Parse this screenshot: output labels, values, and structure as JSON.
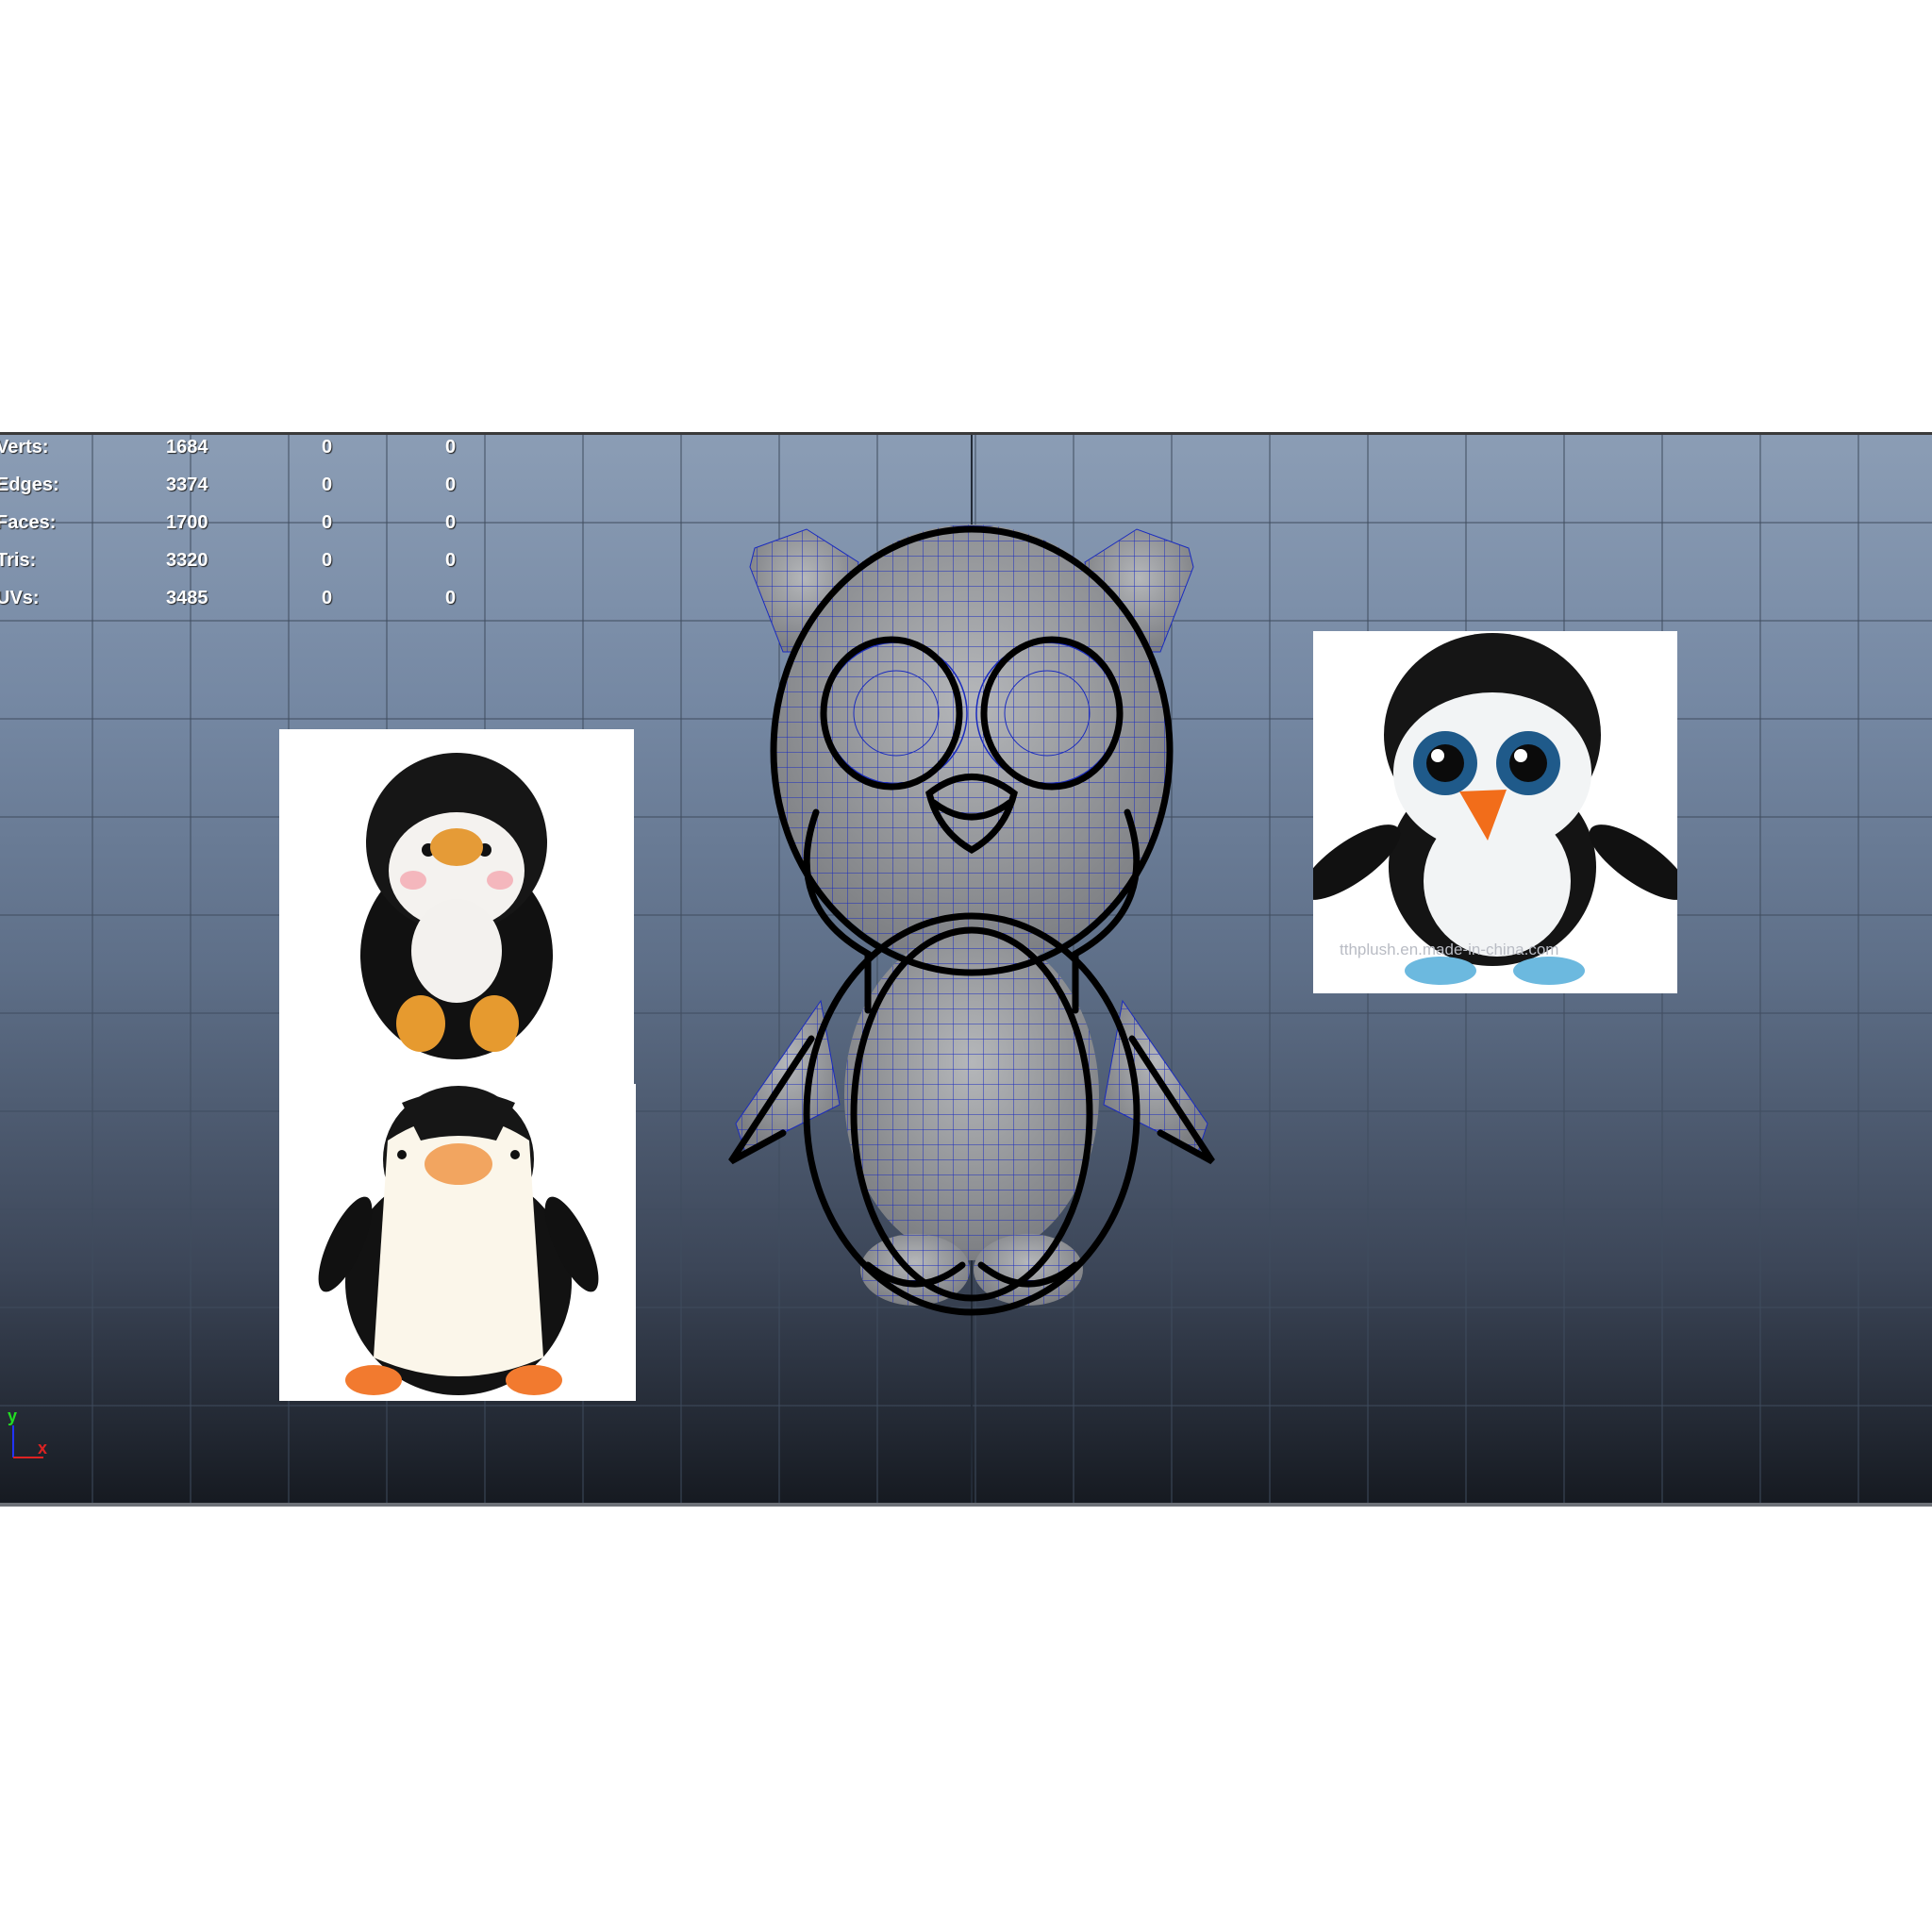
{
  "stats": {
    "rows": [
      {
        "label": "Verts:",
        "value": "1684",
        "col2": "0",
        "col3": "0"
      },
      {
        "label": "Edges:",
        "value": "3374",
        "col2": "0",
        "col3": "0"
      },
      {
        "label": "Faces:",
        "value": "1700",
        "col2": "0",
        "col3": "0"
      },
      {
        "label": "Tris:",
        "value": "3320",
        "col2": "0",
        "col3": "0"
      },
      {
        "label": "UVs:",
        "value": "3485",
        "col2": "0",
        "col3": "0"
      }
    ]
  },
  "axis": {
    "y_label": "y",
    "x_label": "x",
    "y_color": "#22dd22",
    "x_color": "#dd2222"
  },
  "references": {
    "watermark": "tthplush.en.made-in-china.com"
  },
  "colors": {
    "viewport_top": "#8b9db5",
    "viewport_bottom": "#161a21",
    "grid_line": "#3f4c5e",
    "wireframe": "#1a2bbf",
    "model_fill": "#9a9ca0",
    "sketch_stroke": "#000000"
  }
}
